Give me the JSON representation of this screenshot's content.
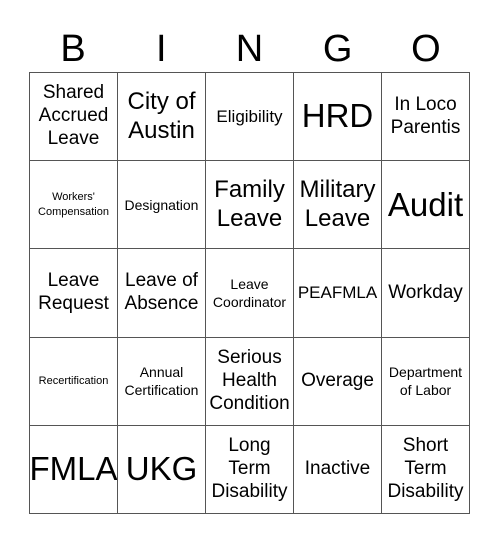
{
  "header": {
    "letters": [
      "B",
      "I",
      "N",
      "G",
      "O"
    ]
  },
  "board": {
    "rows": [
      [
        {
          "text": "Shared Accrued Leave",
          "size": "fs-m"
        },
        {
          "text": "City of Austin",
          "size": "fs-l"
        },
        {
          "text": "Eligibility",
          "size": "fs-s"
        },
        {
          "text": "HRD",
          "size": "fs-xl"
        },
        {
          "text": "In Loco Parentis",
          "size": "fs-m"
        }
      ],
      [
        {
          "text": "Workers' Compensation",
          "size": "fs-xxs"
        },
        {
          "text": "Designation",
          "size": "fs-xs"
        },
        {
          "text": "Family Leave",
          "size": "fs-l"
        },
        {
          "text": "Military Leave",
          "size": "fs-l"
        },
        {
          "text": "Audit",
          "size": "fs-xl"
        }
      ],
      [
        {
          "text": "Leave Request",
          "size": "fs-m"
        },
        {
          "text": "Leave of Absence",
          "size": "fs-m"
        },
        {
          "text": "Leave Coordinator",
          "size": "fs-xs"
        },
        {
          "text": "PEAFMLA",
          "size": "fs-s"
        },
        {
          "text": "Workday",
          "size": "fs-m"
        }
      ],
      [
        {
          "text": "Recertification",
          "size": "fs-xxs"
        },
        {
          "text": "Annual Certification",
          "size": "fs-xs"
        },
        {
          "text": "Serious Health Condition",
          "size": "fs-m"
        },
        {
          "text": "Overage",
          "size": "fs-m"
        },
        {
          "text": "Department of Labor",
          "size": "fs-xs"
        }
      ],
      [
        {
          "text": "FMLA",
          "size": "fs-xl"
        },
        {
          "text": "UKG",
          "size": "fs-xl"
        },
        {
          "text": "Long Term Disability",
          "size": "fs-m"
        },
        {
          "text": "Inactive",
          "size": "fs-m"
        },
        {
          "text": "Short Term Disability",
          "size": "fs-m"
        }
      ]
    ]
  },
  "colors": {
    "grid_line": "#555555",
    "text": "#000000",
    "background": "#ffffff"
  }
}
